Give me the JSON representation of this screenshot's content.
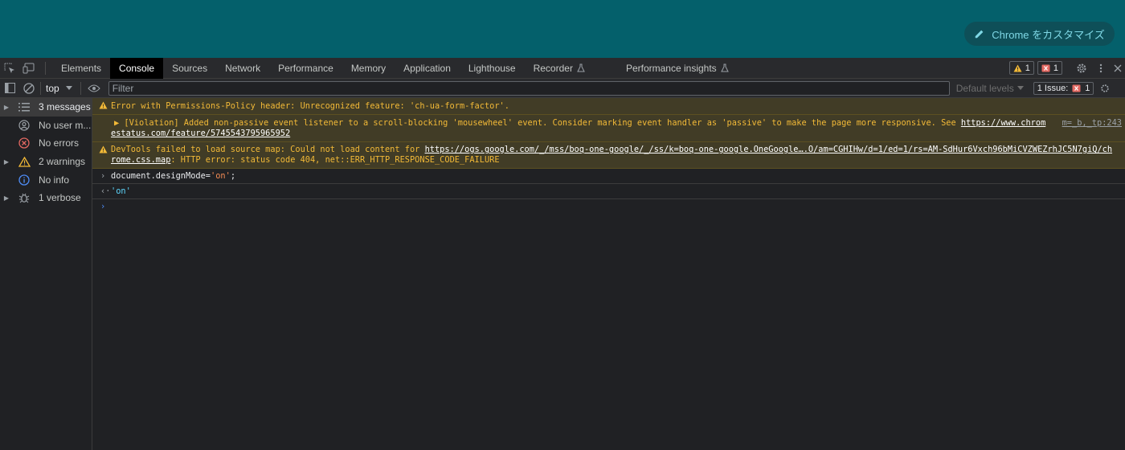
{
  "page": {
    "customize_button": "Chrome をカスタマイズ"
  },
  "tabbar": {
    "tabs": [
      "Elements",
      "Console",
      "Sources",
      "Network",
      "Performance",
      "Memory",
      "Application",
      "Lighthouse",
      "Recorder",
      "Performance insights"
    ],
    "active_tab": "Console",
    "warning_count": "1",
    "error_count": "1"
  },
  "toolbar": {
    "context": "top",
    "filter_placeholder": "Filter",
    "levels_label": "Default levels",
    "issues_label": "1 Issue:",
    "issues_count": "1"
  },
  "sidebar": {
    "items": [
      {
        "label": "3 messages",
        "icon": "list-icon"
      },
      {
        "label": "No user m...",
        "icon": "user-icon"
      },
      {
        "label": "No errors",
        "icon": "error-circle-icon"
      },
      {
        "label": "2 warnings",
        "icon": "warning-icon"
      },
      {
        "label": "No info",
        "icon": "info-icon"
      },
      {
        "label": "1 verbose",
        "icon": "bug-icon"
      }
    ]
  },
  "messages": {
    "m1": {
      "text": "Error with Permissions-Policy header: Unrecognized feature: 'ch-ua-form-factor'."
    },
    "m2": {
      "text": "▶ [Violation] Added non-passive event listener to a scroll-blocking 'mousewheel' event. Consider marking event handler as 'passive' to make the page more responsive. See ",
      "link1": "https://www.chrom",
      "source": "m=_b,_tp:243",
      "link2": "estatus.com/feature/5745543795965952"
    },
    "m3": {
      "prefix": "DevTools failed to load source map: Could not load content for ",
      "link1": "https://ogs.google.com/_/mss/boq-one-google/_/ss/k=boq-one-google.OneGoogle….O/am=CGHIHw/d=1/ed=1/rs=AM-SdHur6Vxch96bMiCVZWEZrhJC5N7giQ/ch",
      "link2": "rome.css.map",
      "suffix": ": HTTP error: status code 404, net::ERR_HTTP_RESPONSE_CODE_FAILURE"
    },
    "cmd": {
      "prefix": "document.designMode=",
      "value": "'on'",
      "suffix": ";"
    },
    "result": "'on'"
  },
  "colors": {
    "page_bg": "#04606b",
    "warn_bg": "#413c26",
    "warn_text": "#f2b937"
  }
}
